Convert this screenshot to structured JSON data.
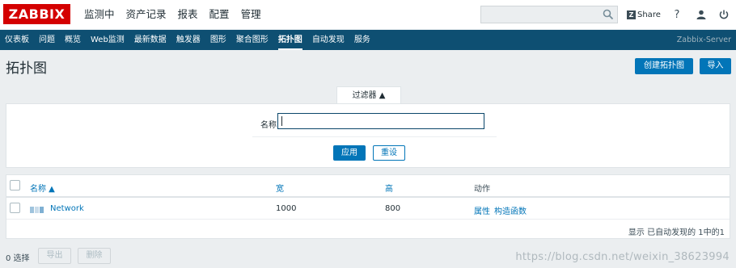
{
  "brand": {
    "logo": "ZABBIX",
    "logo_color": "#d40000"
  },
  "topnav": [
    "监测中",
    "资产记录",
    "报表",
    "配置",
    "管理"
  ],
  "search": {
    "placeholder": ""
  },
  "share_label": "Share",
  "icons": {
    "search": "search-icon",
    "share": "zabbix-share-icon",
    "help": "help-icon",
    "user": "user-icon",
    "power": "power-icon"
  },
  "subnav": {
    "items": [
      "仪表板",
      "问题",
      "概览",
      "Web监测",
      "最新数据",
      "触发器",
      "图形",
      "聚合图形",
      "拓扑图",
      "自动发现",
      "服务"
    ],
    "active": "拓扑图",
    "server": "Zabbix-Server"
  },
  "page": {
    "title": "拓扑图",
    "create_button": "创建拓扑图",
    "import_button": "导入"
  },
  "filter": {
    "tab_label": "过滤器 ▲",
    "name_label": "名称",
    "name_value": "",
    "apply_label": "应用",
    "reset_label": "重设"
  },
  "table": {
    "headers": {
      "name": "名称 ▲",
      "width": "宽",
      "height": "高",
      "actions": "动作"
    },
    "rows": [
      {
        "name": "Network",
        "width": "1000",
        "height": "800",
        "action_props": "属性",
        "action_constructor": "构造函数"
      }
    ],
    "footer": "显示 已自动发现的 1中的1"
  },
  "bottom": {
    "selected": "0 选择",
    "export_label": "导出",
    "delete_label": "删除"
  },
  "watermark": "https://blog.csdn.net/weixin_38623994",
  "colors": {
    "header_bg": "#0e4f72",
    "accent": "#0275b8",
    "page_bg": "#ebeef0"
  }
}
